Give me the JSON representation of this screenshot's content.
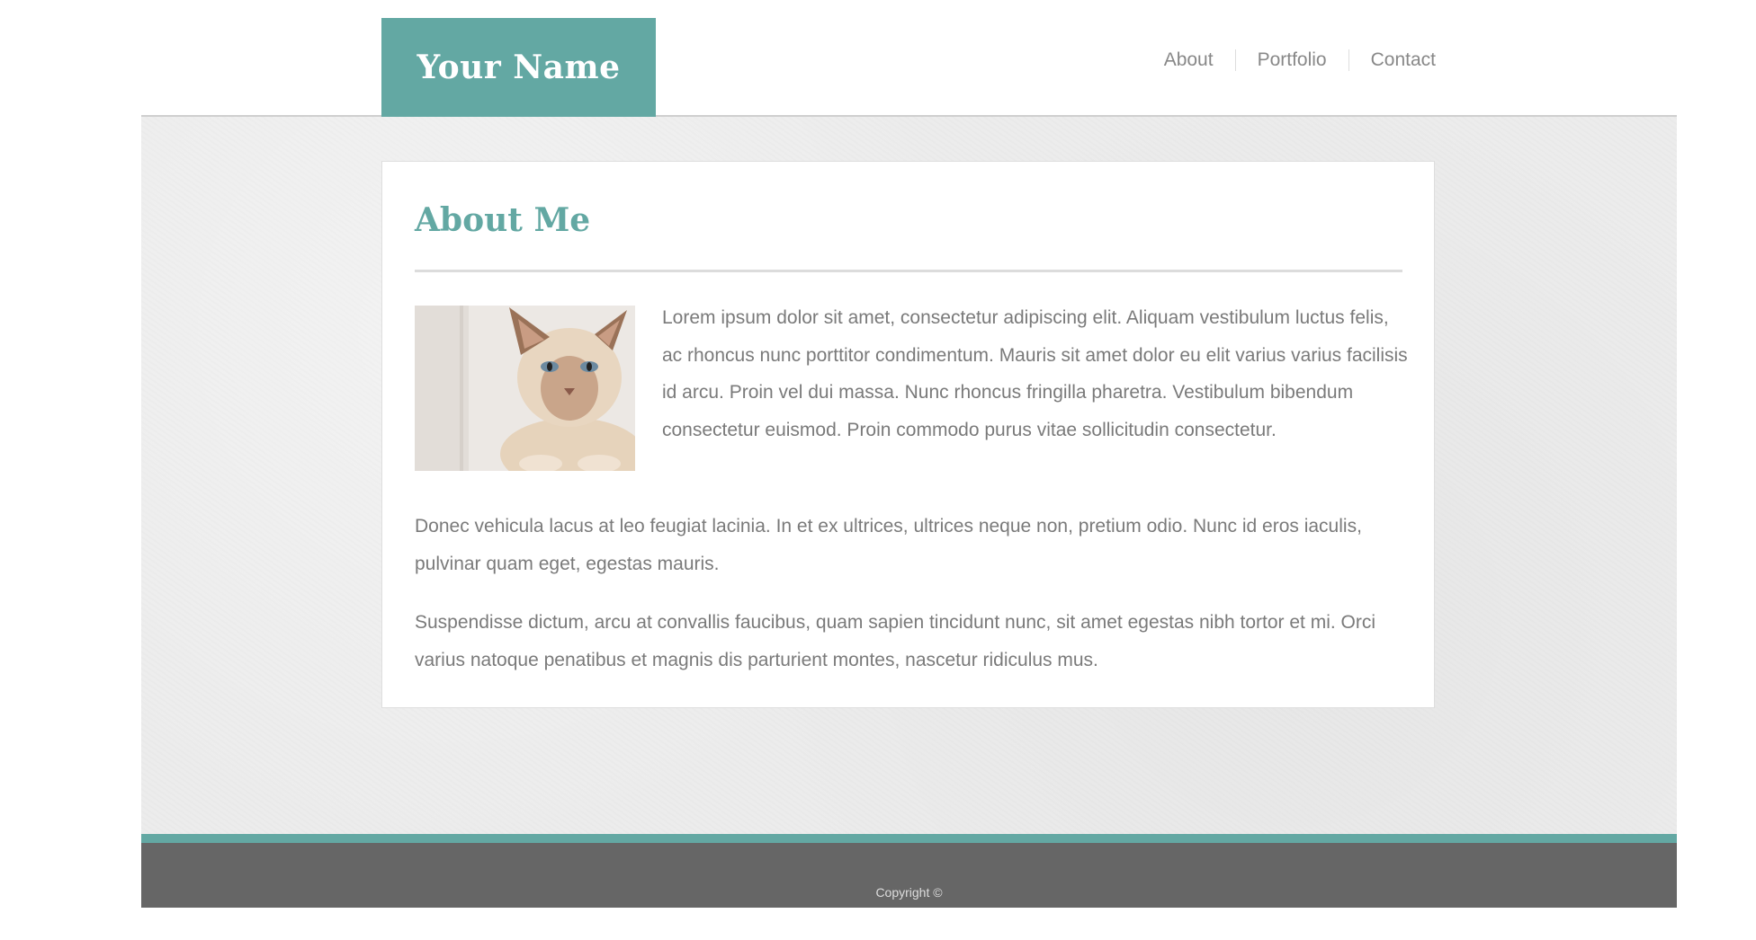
{
  "header": {
    "site_name": "Your Name",
    "nav": [
      "About",
      "Portfolio",
      "Contact"
    ]
  },
  "main": {
    "heading": "About Me",
    "photo": "cat-photo",
    "paragraphs": [
      "Lorem ipsum dolor sit amet, consectetur adipiscing elit. Aliquam vestibulum luctus felis, ac rhoncus nunc porttitor condimentum. Mauris sit amet dolor eu elit varius varius facilisis id arcu. Proin vel dui massa. Nunc rhoncus fringilla pharetra. Vestibulum bibendum consectetur euismod. Proin commodo purus vitae sollicitudin consectetur.",
      "Donec vehicula lacus at leo feugiat lacinia. In et ex ultrices, ultrices neque non, pretium odio. Nunc id eros iaculis, pulvinar quam eget, egestas mauris.",
      "Suspendisse dictum, arcu at convallis faucibus, quam sapien tincidunt nunc, sit amet egestas nibh tortor et mi. Orci varius natoque penatibus et magnis dis parturient montes, nascetur ridiculus mus."
    ]
  },
  "footer": {
    "copyright": "Copyright ©"
  },
  "colors": {
    "accent": "#63a8a3",
    "footer": "#666666",
    "text": "#7a7a7a"
  }
}
